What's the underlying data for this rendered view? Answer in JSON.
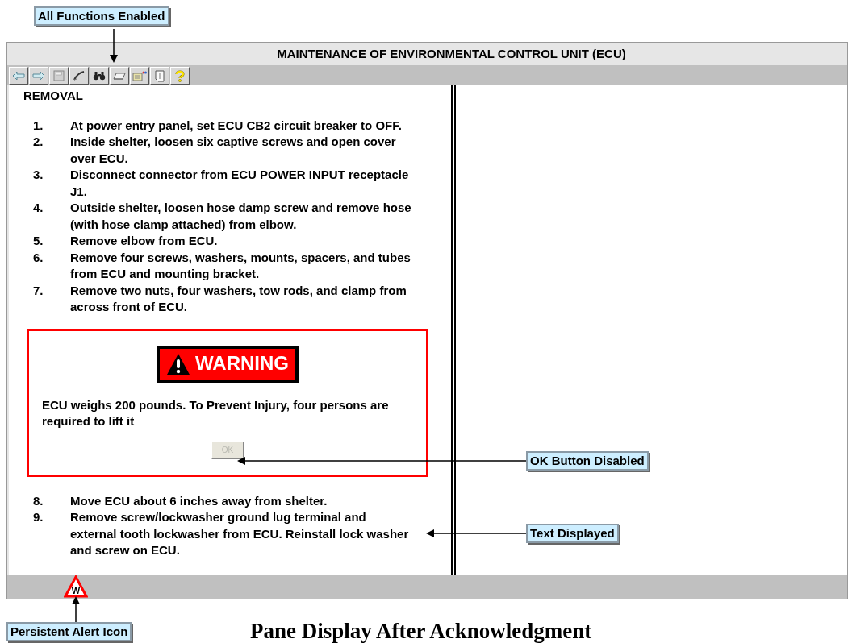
{
  "window": {
    "title": "MAINTENANCE OF ENVIRONMENTAL CONTROL UNIT (ECU)"
  },
  "toolbar": [
    {
      "kind": "back"
    },
    {
      "kind": "forward"
    },
    {
      "kind": "save"
    },
    {
      "kind": "pen"
    },
    {
      "kind": "binoculars"
    },
    {
      "kind": "eraser"
    },
    {
      "kind": "note"
    },
    {
      "kind": "page"
    },
    {
      "kind": "help"
    }
  ],
  "section_heading": "REMOVAL",
  "steps_before": [
    {
      "number": "1.",
      "text": "At power entry panel, set ECU CB2 circuit breaker to OFF."
    },
    {
      "number": "2.",
      "text": "Inside shelter, loosen six captive screws and open cover over ECU."
    },
    {
      "number": "3.",
      "text": "Disconnect connector from ECU POWER INPUT receptacle J1."
    },
    {
      "number": "4.",
      "text": "Outside shelter, loosen hose damp screw and remove hose (with hose clamp attached) from elbow."
    },
    {
      "number": "5.",
      "text": "Remove elbow from ECU."
    },
    {
      "number": "6.",
      "text": "Remove four screws, washers, mounts, spacers, and tubes from ECU and mounting bracket."
    },
    {
      "number": "7.",
      "text": "Remove two nuts, four washers, tow rods, and clamp from across front of ECU."
    }
  ],
  "warning": {
    "badge": "WARNING",
    "message": "ECU weighs 200 pounds. To Prevent Injury, four persons are required to lift it",
    "ok_button": {
      "label": "OK",
      "disabled": true
    }
  },
  "steps_after": [
    {
      "number": "8.",
      "text": "Move ECU about 6 inches away from shelter."
    },
    {
      "number": "9.",
      "text": "Remove screw/lockwasher ground lug terminal and external tooth lockwasher from ECU. Reinstall lock washer and screw on ECU."
    }
  ],
  "status_bar": {
    "alert_icon_letter": "W"
  },
  "callouts": {
    "toolbar": "All Functions Enabled",
    "ok_button": "OK Button Disabled",
    "text": "Text Displayed",
    "alert_icon": "Persistent Alert Icon"
  },
  "caption": "Pane Display After Acknowledgment"
}
